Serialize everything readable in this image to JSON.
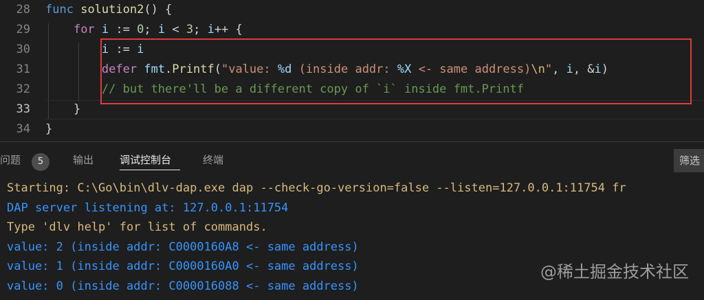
{
  "editor": {
    "lines": [
      {
        "no": "28",
        "tokens": [
          [
            "kw",
            "func"
          ],
          [
            "op",
            " "
          ],
          [
            "fn",
            "solution2"
          ],
          [
            "op",
            "() {"
          ]
        ]
      },
      {
        "no": "29",
        "tokens": [
          [
            "op",
            "    "
          ],
          [
            "kw-defer",
            "for"
          ],
          [
            "op",
            " "
          ],
          [
            "var",
            "i"
          ],
          [
            "op",
            " := "
          ],
          [
            "num",
            "0"
          ],
          [
            "op",
            "; "
          ],
          [
            "var",
            "i"
          ],
          [
            "op",
            " < "
          ],
          [
            "num",
            "3"
          ],
          [
            "op",
            "; "
          ],
          [
            "var",
            "i"
          ],
          [
            "op",
            "++ "
          ],
          [
            "op",
            "{"
          ]
        ]
      },
      {
        "no": "30",
        "tokens": [
          [
            "op",
            "        "
          ],
          [
            "var",
            "i"
          ],
          [
            "op",
            " := "
          ],
          [
            "var",
            "i"
          ]
        ]
      },
      {
        "no": "31",
        "tokens": [
          [
            "op",
            "        "
          ],
          [
            "kw-defer",
            "defer"
          ],
          [
            "op",
            " "
          ],
          [
            "var",
            "fmt"
          ],
          [
            "op",
            "."
          ],
          [
            "fn",
            "Printf"
          ],
          [
            "op",
            "("
          ],
          [
            "str",
            "\"value: "
          ],
          [
            "var",
            "%d"
          ],
          [
            "str",
            " (inside addr: "
          ],
          [
            "var",
            "%X"
          ],
          [
            "str",
            " <- same address)"
          ],
          [
            "esc",
            "\\n"
          ],
          [
            "str",
            "\""
          ],
          [
            "op",
            ", "
          ],
          [
            "var",
            "i"
          ],
          [
            "op",
            ", &"
          ],
          [
            "var",
            "i"
          ],
          [
            "op",
            ")"
          ]
        ]
      },
      {
        "no": "32",
        "tokens": [
          [
            "op",
            "        "
          ],
          [
            "com",
            "// but there'll be a different copy of `i` inside fmt.Printf"
          ]
        ]
      },
      {
        "no": "33",
        "tokens": [
          [
            "op",
            "    "
          ],
          [
            "op",
            "}"
          ]
        ]
      },
      {
        "no": "34",
        "tokens": [
          [
            "op",
            "}"
          ]
        ]
      }
    ],
    "active_line": "33"
  },
  "panel": {
    "tabs": [
      {
        "label": "问题",
        "active": false
      },
      {
        "label": "输出",
        "active": false
      },
      {
        "label": "调试控制台",
        "active": true
      },
      {
        "label": "终端",
        "active": false
      }
    ],
    "problems_count": "5",
    "filter_label": "筛选",
    "output": [
      {
        "text": "Starting: C:\\Go\\bin\\dlv-dap.exe dap --check-go-version=false --listen=127.0.0.1:11754 fr",
        "color": "yellow"
      },
      {
        "text": "DAP server listening at: 127.0.0.1:11754",
        "color": "blue"
      },
      {
        "text": "Type 'dlv help' for list of commands.",
        "color": "yellow"
      },
      {
        "text": "value: 2 (inside addr: C0000160A8 <- same address)",
        "color": "blue"
      },
      {
        "text": "value: 1 (inside addr: C0000160A0 <- same address)",
        "color": "blue"
      },
      {
        "text": "value: 0 (inside addr: C000016088 <- same address)",
        "color": "blue"
      }
    ]
  },
  "watermark": "@稀土掘金技术社区"
}
